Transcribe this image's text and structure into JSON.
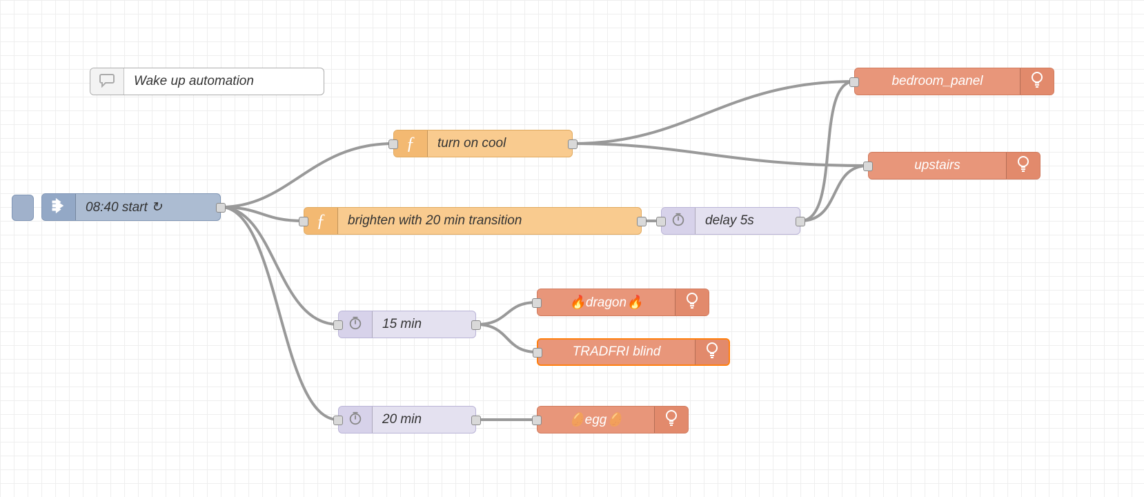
{
  "comment_label": "Wake up automation",
  "nodes": {
    "start": {
      "label": "08:40 start ↻"
    },
    "turn_on": {
      "label": "turn on cool"
    },
    "brighten": {
      "label": "brighten with 20 min transition"
    },
    "delay5": {
      "label": "delay 5s"
    },
    "d15": {
      "label": "15 min"
    },
    "d20": {
      "label": "20 min"
    },
    "bedroom": {
      "label": "bedroom_panel"
    },
    "upstairs": {
      "label": "upstairs"
    },
    "dragon": {
      "label": "🔥dragon🔥"
    },
    "blind": {
      "label": "TRADFRI blind"
    },
    "egg": {
      "label": "🥚egg🥚"
    }
  }
}
